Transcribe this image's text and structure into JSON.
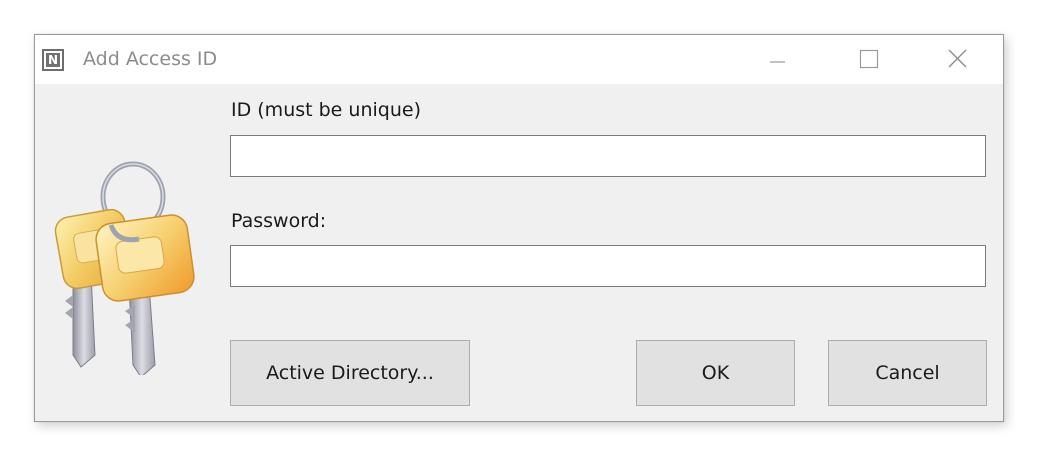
{
  "window": {
    "title": "Add Access ID",
    "icon": "n-app-icon",
    "icon_letter": "N"
  },
  "caption_buttons": {
    "minimize": "minimize-icon",
    "maximize": "maximize-icon",
    "close": "close-icon"
  },
  "illustration": {
    "icon": "keys-icon",
    "colors": {
      "key_gold": "#f2c75c",
      "key_orange": "#f0a030",
      "key_metal": "#b9b9c4",
      "ring": "#9ea3ad"
    }
  },
  "form": {
    "id_label": "ID (must be unique)",
    "id_value": "",
    "id_placeholder": "",
    "password_label": "Password:",
    "password_value": "",
    "password_placeholder": ""
  },
  "buttons": {
    "active_directory": "Active Directory...",
    "ok": "OK",
    "cancel": "Cancel"
  },
  "colors": {
    "window_bg": "#f0f0f0",
    "titlebar_bg": "#ffffff",
    "button_bg": "#e1e1e1",
    "button_border": "#adadad",
    "input_border": "#7a7a7a"
  }
}
